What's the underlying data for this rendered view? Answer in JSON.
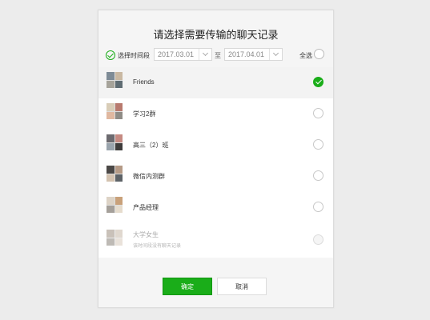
{
  "dialog": {
    "title": "请选择需要传输的聊天记录",
    "filter": {
      "time_range_label": "选择时间段",
      "start_date": "2017.03.01",
      "to_label": "至",
      "end_date": "2017.04.01",
      "select_all_label": "全选"
    },
    "chats": [
      {
        "name": "Friends",
        "subtext": "",
        "state": "checked"
      },
      {
        "name": "学习2群",
        "subtext": "",
        "state": "unchecked"
      },
      {
        "name": "高三（2）班",
        "subtext": "",
        "state": "unchecked"
      },
      {
        "name": "微信内测群",
        "subtext": "",
        "state": "unchecked"
      },
      {
        "name": "产品经理",
        "subtext": "",
        "state": "unchecked"
      },
      {
        "name": "大学女生",
        "subtext": "该时间段没有聊天记录",
        "state": "disabled"
      }
    ],
    "confirm_label": "确定",
    "cancel_label": "取消"
  },
  "colors": {
    "accent": "#1aad19",
    "background": "#ececec",
    "dialog": "#f5f5f5"
  }
}
